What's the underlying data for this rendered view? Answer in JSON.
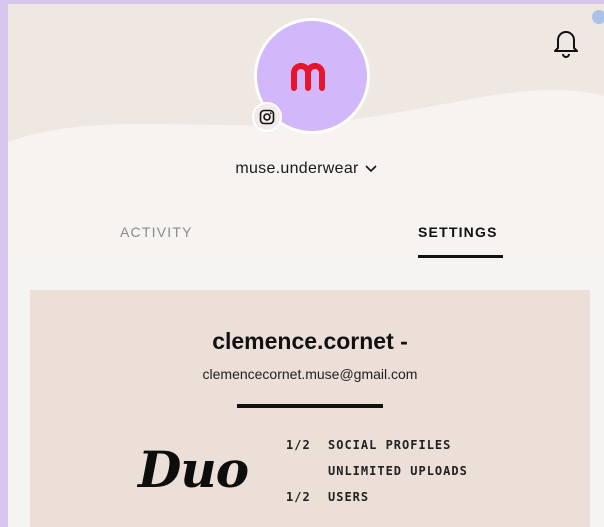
{
  "header": {
    "brand_letter": "m",
    "account_name": "muse.underwear",
    "icons": [
      "bell-icon",
      "instagram-icon",
      "chevron-down-icon"
    ],
    "colors": {
      "avatar_bg": "#d2b8fb",
      "brand_red": "#e8132d",
      "hero_bg": "#f0e9e4"
    }
  },
  "tabs": [
    {
      "label": "ACTIVITY",
      "active": false
    },
    {
      "label": "SETTINGS",
      "active": true
    }
  ],
  "profile": {
    "name": "clemence.cornet -",
    "email": "clemencecornet.muse@gmail.com"
  },
  "plan": {
    "name": "Duo",
    "features": [
      {
        "count": "1/2",
        "label": "SOCIAL PROFILES"
      },
      {
        "count": "",
        "label": "UNLIMITED UPLOADS"
      },
      {
        "count": "1/2",
        "label": "USERS"
      }
    ]
  }
}
